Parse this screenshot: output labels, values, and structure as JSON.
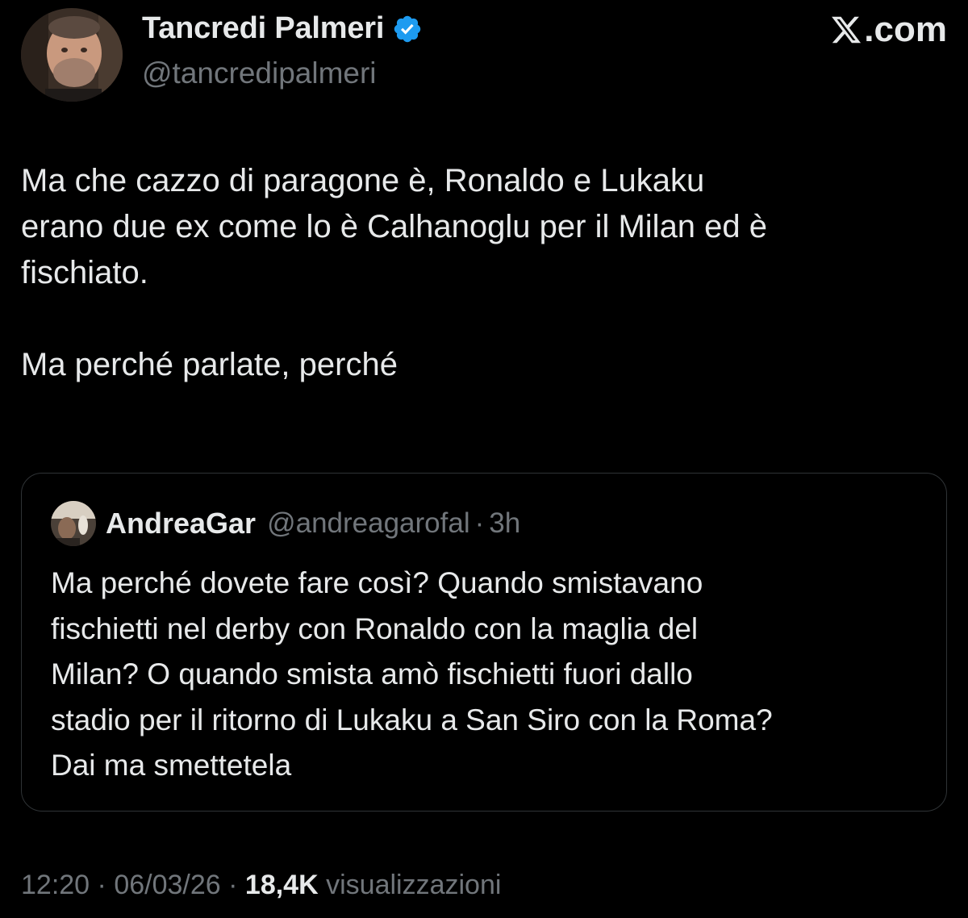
{
  "author": {
    "name": "Tancredi Palmeri",
    "handle": "@tancredipalmeri",
    "verified": true
  },
  "brand": {
    "label": ".com",
    "icon": "x-logo-icon"
  },
  "tweet": {
    "text": "Ma che cazzo di paragone è, Ronaldo e Lukaku\nerano due ex come lo è Calhanoglu per il Milan ed è\nfischiato.\n\nMa perché parlate, perché"
  },
  "quote": {
    "name": "AndreaGar",
    "handle": "@andreagarofal",
    "separator": "·",
    "time": "3h",
    "text": "Ma perché dovete fare così? Quando smistavano\nfischietti nel derby con Ronaldo con la maglia del\nMilan? O quando smista amò fischietti fuori dallo\nstadio per il ritorno di Lukaku a San Siro con la Roma?\nDai ma smettetela"
  },
  "meta": {
    "time": "12:20",
    "sep1": "·",
    "date": "06/03/26",
    "sep2": "·",
    "views_count": "18,4K",
    "views_label": "visualizzazioni"
  },
  "colors": {
    "background": "#000000",
    "text_primary": "#e7e9ea",
    "text_secondary": "#71767b",
    "verified_blue": "#1d9bf0",
    "border": "#2f3336"
  }
}
